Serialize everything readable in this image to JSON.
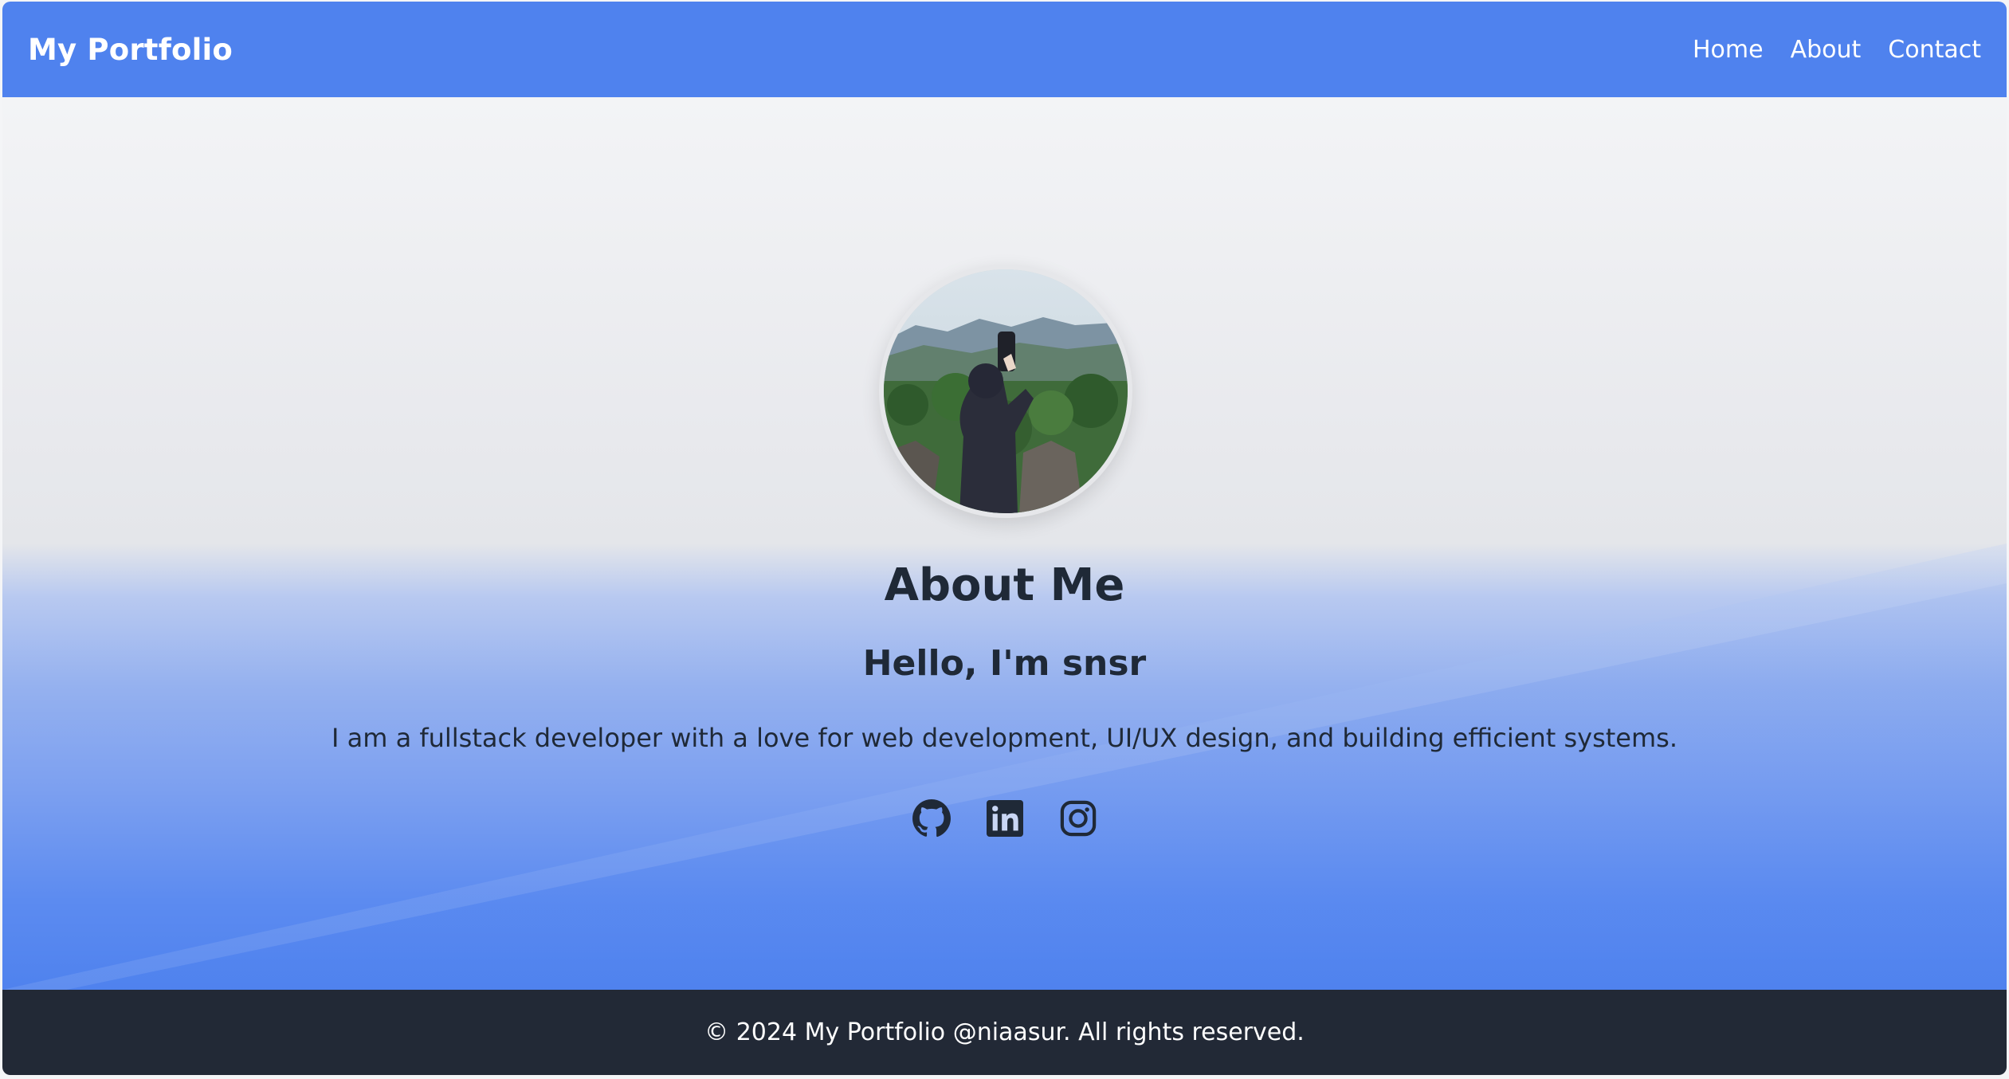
{
  "navbar": {
    "brand": "My Portfolio",
    "links": [
      "Home",
      "About",
      "Contact"
    ]
  },
  "hero": {
    "title": "About Me",
    "greeting": "Hello, I'm snsr",
    "bio": "I am a fullstack developer with a love for web development, UI/UX design, and building efficient systems.",
    "socials": [
      "github-icon",
      "linkedin-icon",
      "instagram-icon"
    ]
  },
  "footer": {
    "text": "© 2024 My Portfolio @niaasur. All rights reserved."
  },
  "colors": {
    "primary": "#4f82ee",
    "dark": "#222936",
    "text": "#1f2937"
  }
}
